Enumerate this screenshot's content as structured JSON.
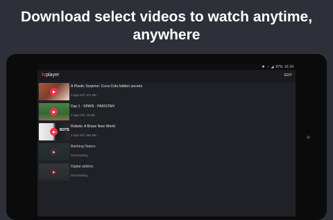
{
  "headline": {
    "line1": "Download select videos to watch anytime,",
    "line2": "anywhere"
  },
  "status_bar": {
    "icons": [
      "bluetooth-icon",
      "wifi-icon",
      "signal-icon"
    ],
    "battery": "87%",
    "time": "01:24"
  },
  "app_bar": {
    "logo_prefix": "tv",
    "logo_suffix": "player",
    "edit_label": "EDIT"
  },
  "videos": [
    {
      "title": "A Plastic Surprise: Coca-Cola hidden secrets",
      "meta": "2 days left | 972 MB",
      "state": "downloaded",
      "thumb_text": ""
    },
    {
      "title": "Day 1 - SPAIN - PAKISTAN",
      "meta": "2 days left | 30 MB",
      "state": "downloaded",
      "thumb_text": ""
    },
    {
      "title": "Robots: A Brave New World",
      "meta": "2 days left | 884 MB",
      "state": "downloaded",
      "thumb_text": "BOTS"
    },
    {
      "title": "Banking Nature",
      "meta": "Downloading",
      "state": "downloading",
      "thumb_text": ""
    },
    {
      "title": "Digital addicts",
      "meta": "Downloading",
      "state": "downloading",
      "thumb_text": ""
    }
  ],
  "colors": {
    "background": "#2d3038",
    "accent": "#e8374a",
    "screen": "#202126"
  }
}
